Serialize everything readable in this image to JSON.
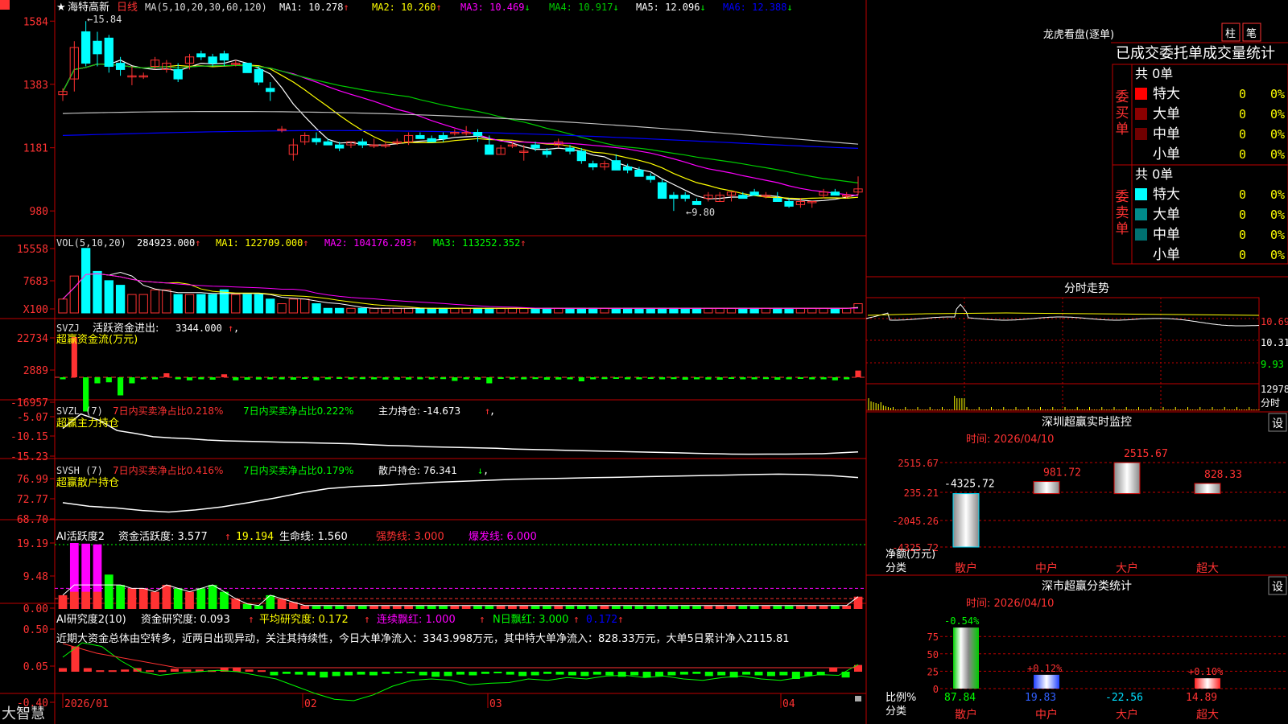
{
  "colors": {
    "up": "#ff3232",
    "down": "#00ffff",
    "axis": "#c00000",
    "white": "#ffffff",
    "yellow": "#ffff00",
    "magenta": "#ff00ff",
    "green": "#00cc00",
    "blue": "#0000ff",
    "gray": "#c0c0c0",
    "green_bar": "#00ff00"
  },
  "stock": {
    "marker": "★",
    "name": "海特高新",
    "period": "日线",
    "ma_label": "MA(5,10,20,30,60,120)",
    "logo": "大智慧",
    "bottom_icon": "lock-icon"
  },
  "main_chart": {
    "ma_values": [
      {
        "label": "MA1:",
        "value": "10.278",
        "arrow": "↑"
      },
      {
        "label": "MA2:",
        "value": "10.260",
        "arrow": "↑"
      },
      {
        "label": "MA3:",
        "value": "10.469",
        "arrow": "↓"
      },
      {
        "label": "MA4:",
        "value": "10.917",
        "arrow": "↓"
      },
      {
        "label": "MA5:",
        "value": "12.096",
        "arrow": "↓"
      },
      {
        "label": "MA6:",
        "value": "12.388",
        "arrow": "↓"
      }
    ],
    "y_ticks": [
      "1584",
      "1383",
      "1181",
      "980"
    ],
    "high_label": "←15.84",
    "low_label": "←9.80",
    "x_ticks": [
      "2026/01",
      "02",
      "03",
      "04"
    ]
  },
  "vol_panel": {
    "label": "VOL(5,10,20)",
    "values": [
      {
        "text": "284923.000",
        "arrow": "↑"
      },
      {
        "text": "MA1: 122709.000",
        "arrow": "↑"
      },
      {
        "text": "MA2: 104176.203",
        "arrow": "↑"
      },
      {
        "text": "MA3: 113252.352",
        "arrow": "↑"
      }
    ],
    "y_ticks": [
      "15558",
      "7683",
      "X100"
    ]
  },
  "svzj_panel": {
    "label": "SVZJ",
    "title": "活跃资金进出:",
    "value": "3344.000",
    "arrow": "↑",
    "comma": ",",
    "subtitle": "超赢资金流(万元)",
    "y_ticks": [
      "22734",
      "2889",
      "-16957"
    ]
  },
  "svzl_panel": {
    "label": "SVZL (7)",
    "t1": "7日内买卖净占比0.218%",
    "t2": "7日内买卖净占比0.222%",
    "t3": "主力持仓: -14.673",
    "arrow": "↑",
    "comma": ",",
    "subtitle": "超赢主力持仓",
    "y_ticks": [
      "-5.07",
      "-10.15",
      "-15.23"
    ]
  },
  "svsh_panel": {
    "label": "SVSH (7)",
    "t1": "7日内买卖净占比0.416%",
    "t2": "7日内买卖净占比0.179%",
    "t3": "散户持仓: 76.341",
    "arrow": "↓",
    "comma": ",",
    "subtitle": "超赢散户持仓",
    "y_ticks": [
      "76.99",
      "72.77",
      "68.70"
    ]
  },
  "ai1_panel": {
    "label": "AI活跃度2",
    "t1": "资金活跃度: 3.577",
    "a1": "↑",
    "t2": "19.194",
    "t3": "生命线: 1.560",
    "t4": "强势线: 3.000",
    "t5": "爆发线: 6.000",
    "comma": ",",
    "y_ticks": [
      "19.19",
      "9.48",
      "0.00"
    ]
  },
  "ai2_panel": {
    "label": "AI研究度2(10)",
    "t1": "资金研究度: 0.093",
    "a1": "↑",
    "t2": "平均研究度: 0.172",
    "a2": "↑",
    "t3": "连续飘红: 1.000",
    "a3": "↑",
    "t4": "N日飘红: 3.000",
    "a4": "↑",
    "t5": "0.172",
    "a5": "↑",
    "comma": ",",
    "note": "近期大资金总体由空转多，近两日出现异动，关注其持续性，今日大单净流入：3343.998万元，其中特大单净流入：828.33万元，大单5日累计净入2115.81",
    "y_ticks": [
      "0.50",
      "0.05",
      "-0.40"
    ]
  },
  "right": {
    "lhkp_title": "龙虎看盘(逐单)",
    "btn_zhu": "柱",
    "btn_bi": "笔",
    "stats_title": "已成交委托单成交量统计",
    "buy_label": [
      "委",
      "买",
      "单"
    ],
    "sell_label": [
      "委",
      "卖",
      "单"
    ],
    "buy_total": "共 0单",
    "sell_total": "共 0单",
    "buy_rows": [
      {
        "name": "特大",
        "count": "0",
        "pct": "0%"
      },
      {
        "name": "大单",
        "count": "0",
        "pct": "0%"
      },
      {
        "name": "中单",
        "count": "0",
        "pct": "0%"
      },
      {
        "name": "小单",
        "count": "0",
        "pct": "0%"
      }
    ],
    "sell_rows": [
      {
        "name": "特大",
        "count": "0",
        "pct": "0%"
      },
      {
        "name": "大单",
        "count": "0",
        "pct": "0%"
      },
      {
        "name": "中单",
        "count": "0",
        "pct": "0%"
      },
      {
        "name": "小单",
        "count": "0",
        "pct": "0%"
      }
    ],
    "intraday_title": "分时走势",
    "intraday_ticks": [
      "10.69",
      "10.31",
      "9.93",
      "12978",
      "分时"
    ],
    "sz_title": "深圳超赢实时监控",
    "sz_btn": "设",
    "sz_time": "时间: 2026/04/10",
    "sz_ticks": [
      "2515.67",
      "235.21",
      "-2045.26",
      "-4325.72"
    ],
    "sz_ylabel": [
      "净额(万元)",
      "分类"
    ],
    "sz_chart": {
      "type": "bar",
      "categories": [
        "散户",
        "中户",
        "大户",
        "超大"
      ],
      "values": [
        -4325.72,
        981.72,
        2515.67,
        828.33
      ],
      "value_labels": [
        "-4325.72",
        "981.72",
        "2515.67",
        "828.33"
      ],
      "ylim": [
        -4325.72,
        2515.67
      ]
    },
    "sc_title": "深市超赢分类统计",
    "sc_btn": "设",
    "sc_time": "时间: 2026/04/10",
    "sc_ticks": [
      "75",
      "50",
      "25",
      "0"
    ],
    "sc_ylabel": [
      "比例%",
      "分类"
    ],
    "sc_chart": {
      "type": "bar",
      "categories": [
        "散户",
        "中户",
        "大户",
        "超大"
      ],
      "values": [
        87.84,
        19.83,
        -22.56,
        14.89
      ],
      "top_labels": [
        "-0.54%",
        "+0.12%",
        "",
        "+0.10%"
      ],
      "bottom_labels": [
        "87.84",
        "19.83",
        "-22.56",
        "14.89"
      ],
      "ylim": [
        0,
        90
      ]
    }
  },
  "chart_data": [
    {
      "type": "candlestick",
      "title": "海特高新 日线",
      "ylim": [
        9.8,
        15.84
      ],
      "high": 15.84,
      "low": 9.8,
      "ohlc": [
        [
          13.5,
          13.7,
          13.3,
          13.6
        ],
        [
          14.0,
          15.2,
          13.6,
          15.0
        ],
        [
          15.5,
          15.84,
          14.4,
          14.5
        ],
        [
          15.2,
          15.5,
          14.4,
          14.8
        ],
        [
          15.3,
          15.4,
          14.2,
          14.4
        ],
        [
          14.5,
          14.7,
          14.1,
          14.3
        ],
        [
          14.1,
          14.4,
          13.8,
          14.1
        ],
        [
          14.1,
          14.2,
          14.0,
          14.1
        ],
        [
          14.4,
          14.7,
          14.3,
          14.6
        ],
        [
          14.3,
          14.6,
          14.2,
          14.5
        ],
        [
          14.3,
          14.5,
          13.9,
          14.0
        ],
        [
          14.5,
          14.8,
          14.3,
          14.7
        ],
        [
          14.8,
          14.9,
          14.6,
          14.7
        ],
        [
          14.7,
          14.8,
          14.4,
          14.5
        ],
        [
          14.8,
          14.9,
          14.4,
          14.6
        ],
        [
          14.5,
          14.6,
          14.4,
          14.5
        ],
        [
          14.5,
          14.5,
          14.2,
          14.2
        ],
        [
          14.3,
          14.4,
          13.8,
          13.9
        ],
        [
          13.7,
          13.9,
          13.3,
          13.6
        ],
        [
          12.4,
          12.5,
          12.3,
          12.4
        ],
        [
          11.6,
          12.1,
          11.4,
          11.9
        ],
        [
          12.0,
          12.3,
          11.9,
          12.2
        ],
        [
          12.1,
          12.3,
          11.9,
          12.0
        ],
        [
          12.0,
          12.1,
          11.9,
          11.9
        ],
        [
          11.9,
          12.0,
          11.7,
          11.8
        ],
        [
          11.9,
          12.0,
          11.8,
          12.0
        ],
        [
          12.0,
          12.1,
          11.8,
          11.9
        ],
        [
          11.9,
          12.1,
          11.8,
          11.9
        ],
        [
          11.9,
          12.0,
          11.8,
          11.9
        ],
        [
          12.0,
          12.1,
          11.9,
          12.0
        ],
        [
          12.0,
          12.3,
          11.9,
          12.2
        ],
        [
          12.2,
          12.3,
          12.1,
          12.1
        ],
        [
          12.1,
          12.2,
          12.0,
          12.0
        ],
        [
          12.2,
          12.3,
          12.0,
          12.1
        ],
        [
          12.3,
          12.4,
          12.2,
          12.3
        ],
        [
          12.3,
          12.5,
          12.2,
          12.3
        ],
        [
          12.3,
          12.4,
          12.0,
          12.2
        ],
        [
          11.9,
          12.2,
          11.6,
          11.6
        ],
        [
          11.6,
          11.9,
          11.6,
          11.8
        ],
        [
          11.9,
          12.0,
          11.8,
          11.9
        ],
        [
          11.7,
          11.9,
          11.4,
          11.7
        ],
        [
          11.9,
          12.0,
          11.7,
          11.8
        ],
        [
          11.7,
          11.8,
          11.5,
          11.6
        ],
        [
          11.9,
          12.1,
          11.8,
          12.0
        ],
        [
          11.8,
          11.9,
          11.6,
          11.7
        ],
        [
          11.7,
          11.8,
          11.3,
          11.4
        ],
        [
          11.3,
          11.4,
          11.1,
          11.2
        ],
        [
          11.2,
          11.4,
          11.1,
          11.3
        ],
        [
          11.4,
          11.6,
          11.1,
          11.1
        ],
        [
          11.2,
          11.3,
          11.0,
          11.1
        ],
        [
          11.1,
          11.2,
          10.9,
          10.9
        ],
        [
          10.9,
          11.0,
          10.7,
          10.8
        ],
        [
          10.7,
          10.8,
          10.2,
          10.2
        ],
        [
          10.3,
          10.4,
          9.8,
          10.2
        ],
        [
          10.3,
          10.4,
          10.1,
          10.2
        ],
        [
          10.1,
          10.2,
          10.0,
          10.0
        ],
        [
          10.2,
          10.4,
          10.1,
          10.3
        ],
        [
          10.1,
          10.4,
          10.1,
          10.3
        ],
        [
          10.3,
          10.4,
          10.1,
          10.4
        ],
        [
          10.3,
          10.4,
          10.2,
          10.2
        ],
        [
          10.4,
          10.5,
          10.3,
          10.3
        ],
        [
          10.3,
          10.4,
          10.2,
          10.3
        ],
        [
          10.2,
          10.4,
          10.1,
          10.1
        ],
        [
          10.1,
          10.2,
          9.9,
          9.95
        ],
        [
          10.0,
          10.2,
          9.9,
          10.1
        ],
        [
          10.1,
          10.1,
          9.9,
          10.1
        ],
        [
          10.3,
          10.5,
          10.2,
          10.4
        ],
        [
          10.4,
          10.5,
          10.3,
          10.3
        ],
        [
          10.3,
          10.4,
          10.2,
          10.3
        ],
        [
          10.4,
          10.9,
          10.3,
          10.5
        ]
      ]
    },
    {
      "type": "bar",
      "title": "VOL(5,10,20)",
      "values": [
        3,
        8,
        14,
        9,
        7,
        6,
        4,
        4,
        5,
        5,
        4,
        4,
        4,
        4,
        5,
        4,
        4,
        4,
        3,
        2,
        3,
        3,
        2,
        1,
        1,
        1,
        1,
        1,
        1,
        1,
        1,
        1,
        1,
        1,
        1,
        1,
        1,
        1,
        1,
        1,
        1,
        1,
        1,
        1,
        1,
        1,
        1,
        1,
        1,
        1,
        1,
        1,
        1,
        1,
        1,
        1,
        1,
        1,
        1,
        1,
        1,
        1,
        1,
        1,
        1,
        1,
        1,
        1,
        1,
        2
      ]
    },
    {
      "type": "bar",
      "title": "活跃资金进出",
      "values": [
        -1000,
        20000,
        -17000,
        -3000,
        -2500,
        -9000,
        -3000,
        -1000,
        -1000,
        2000,
        -1000,
        -1500,
        -1000,
        -1200,
        1500,
        -1500,
        -1200,
        -1100,
        -1000,
        -1000,
        -1200,
        -800,
        -1500,
        -1000,
        -800,
        -1000,
        -900,
        -1000,
        -1100,
        -1200,
        -1100,
        -1000,
        -1000,
        -900,
        -1800,
        -1000,
        -1200,
        -3000,
        -800,
        -1000,
        -1000,
        -900,
        -1200,
        -1100,
        -1000,
        -2000,
        -1000,
        -900,
        -800,
        -1000,
        -1000,
        -800,
        -1000,
        -900,
        -1200,
        -1000,
        -1100,
        -1200,
        -800,
        -1000,
        -1000,
        -900,
        -1200,
        -1000,
        -800,
        -1000,
        -1000,
        -1500,
        -1000,
        3344
      ]
    },
    {
      "type": "line",
      "title": "主力持仓",
      "values": [
        -9.0,
        -5.5,
        -7.0,
        -9.5,
        -10.2,
        -11,
        -11.3,
        -11.5,
        -11.8,
        -12,
        -12.1,
        -12.2,
        -12.3,
        -12.4,
        -12.5,
        -12.6,
        -12.7,
        -12.9,
        -13.1,
        -13.2,
        -13.4,
        -13.5,
        -13.6,
        -13.7,
        -13.8,
        -14.0,
        -14.1,
        -14.2,
        -14.3,
        -14.4,
        -14.5,
        -14.6,
        -14.7,
        -14.8,
        -14.9,
        -15.0,
        -15.1,
        -15.2,
        -15.23,
        -15.2,
        -15.2,
        -15.15,
        -15.1,
        -14.9,
        -14.67
      ]
    },
    {
      "type": "line",
      "title": "散户持仓",
      "values": [
        71.5,
        70.8,
        70.5,
        70.0,
        69.7,
        70.1,
        70.7,
        71.5,
        72.4,
        73.4,
        74.2,
        74.6,
        74.8,
        75.1,
        75.4,
        75.6,
        75.8,
        76.0,
        76.1,
        76.2,
        76.3,
        76.4,
        76.5,
        76.6,
        76.7,
        76.8,
        76.9,
        76.99,
        76.9,
        76.7,
        76.341
      ]
    },
    {
      "type": "bar",
      "title": "资金活跃度",
      "values": [
        4,
        19.19,
        19.0,
        18.8,
        10,
        7,
        6,
        6,
        5,
        7,
        6,
        5,
        6,
        7,
        5,
        3,
        1.5,
        1,
        4,
        3,
        2,
        1,
        1,
        1,
        1,
        1,
        1,
        1,
        1,
        1,
        1,
        1,
        1,
        1,
        1,
        1,
        1,
        1,
        1,
        1,
        1,
        1,
        1,
        1,
        1,
        1,
        1,
        1,
        1,
        1,
        1,
        1,
        1,
        1,
        1,
        1,
        1,
        1,
        1,
        1,
        1,
        1,
        1,
        1,
        1,
        1,
        1,
        1,
        1,
        3.577
      ]
    },
    {
      "type": "bar",
      "title": "资金研究度",
      "values": [
        0.05,
        0.35,
        0.05,
        0.02,
        0.02,
        0.03,
        0.05,
        0.02,
        0.02,
        0.04,
        0.03,
        0.03,
        0.02,
        0.06,
        0.05,
        0.03,
        0.02,
        -0.05,
        -0.03,
        -0.04,
        -0.05,
        -0.08,
        -0.06,
        -0.05,
        -0.04,
        -0.05,
        -0.03,
        -0.02,
        -0.02,
        -0.05,
        -0.07,
        -0.06,
        -0.04,
        -0.05,
        -0.03,
        -0.02,
        -0.04,
        -0.06,
        -0.05,
        -0.03,
        -0.04,
        -0.05,
        -0.06,
        -0.04,
        -0.05,
        -0.07,
        -0.05,
        -0.08,
        -0.06,
        -0.05,
        -0.04,
        -0.03,
        -0.06,
        -0.05,
        -0.08,
        -0.04,
        -0.05,
        -0.06,
        -0.05,
        -0.1,
        -0.06,
        -0.05,
        0.05,
        -0.08,
        0.093
      ]
    }
  ]
}
